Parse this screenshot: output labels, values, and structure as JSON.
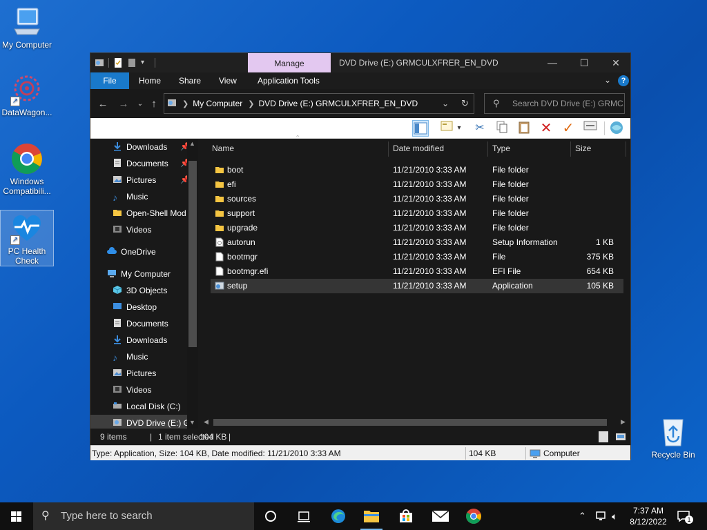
{
  "desktop": {
    "icons": [
      {
        "label": "My Computer"
      },
      {
        "label": "DataWagon..."
      },
      {
        "label": "Windows Compatibili..."
      },
      {
        "label": "PC Health Check"
      },
      {
        "label": "Recycle Bin"
      }
    ]
  },
  "window": {
    "manage_label": "Manage",
    "title": "DVD Drive (E:) GRMCULXFRER_EN_DVD",
    "ribbon_tabs": [
      "File",
      "Home",
      "Share",
      "View",
      "Application Tools"
    ],
    "address": {
      "crumbs": [
        "My Computer",
        "DVD Drive (E:) GRMCULXFRER_EN_DVD"
      ]
    },
    "search_placeholder": "Search DVD Drive (E:) GRMC...",
    "nav_items": [
      {
        "label": "Downloads",
        "pinned": true
      },
      {
        "label": "Documents",
        "pinned": true
      },
      {
        "label": "Pictures",
        "pinned": true
      },
      {
        "label": "Music"
      },
      {
        "label": "Open-Shell Mod"
      },
      {
        "label": "Videos"
      },
      {
        "label": "OneDrive"
      },
      {
        "label": "My Computer"
      },
      {
        "label": "3D Objects"
      },
      {
        "label": "Desktop"
      },
      {
        "label": "Documents"
      },
      {
        "label": "Downloads"
      },
      {
        "label": "Music"
      },
      {
        "label": "Pictures"
      },
      {
        "label": "Videos"
      },
      {
        "label": "Local Disk (C:)"
      },
      {
        "label": "DVD Drive (E:) GI"
      }
    ],
    "columns": [
      "Name",
      "Date modified",
      "Type",
      "Size"
    ],
    "files": [
      {
        "name": "boot",
        "date": "11/21/2010 3:33 AM",
        "type": "File folder",
        "size": "",
        "kind": "folder"
      },
      {
        "name": "efi",
        "date": "11/21/2010 3:33 AM",
        "type": "File folder",
        "size": "",
        "kind": "folder"
      },
      {
        "name": "sources",
        "date": "11/21/2010 3:33 AM",
        "type": "File folder",
        "size": "",
        "kind": "folder"
      },
      {
        "name": "support",
        "date": "11/21/2010 3:33 AM",
        "type": "File folder",
        "size": "",
        "kind": "folder"
      },
      {
        "name": "upgrade",
        "date": "11/21/2010 3:33 AM",
        "type": "File folder",
        "size": "",
        "kind": "folder"
      },
      {
        "name": "autorun",
        "date": "11/21/2010 3:33 AM",
        "type": "Setup Information",
        "size": "1 KB",
        "kind": "inf"
      },
      {
        "name": "bootmgr",
        "date": "11/21/2010 3:33 AM",
        "type": "File",
        "size": "375 KB",
        "kind": "file"
      },
      {
        "name": "bootmgr.efi",
        "date": "11/21/2010 3:33 AM",
        "type": "EFI File",
        "size": "654 KB",
        "kind": "file"
      },
      {
        "name": "setup",
        "date": "11/21/2010 3:33 AM",
        "type": "Application",
        "size": "105 KB",
        "kind": "app",
        "selected": true
      }
    ],
    "status": {
      "items": "9 items",
      "selected": "1 item selected",
      "selected_size": "104 KB"
    },
    "details_bar": {
      "info": "Type: Application, Size: 104 KB, Date modified: 11/21/2010 3:33 AM",
      "size": "104 KB",
      "location": "Computer"
    }
  },
  "taskbar": {
    "search_placeholder": "Type here to search",
    "time": "7:37 AM",
    "date": "8/12/2022",
    "notification_count": "1"
  },
  "colors": {
    "accent": "#1979ca",
    "manage_tab": "#e3c8f0",
    "folder": "#f5c542",
    "desktop": "#0c5ac0"
  }
}
